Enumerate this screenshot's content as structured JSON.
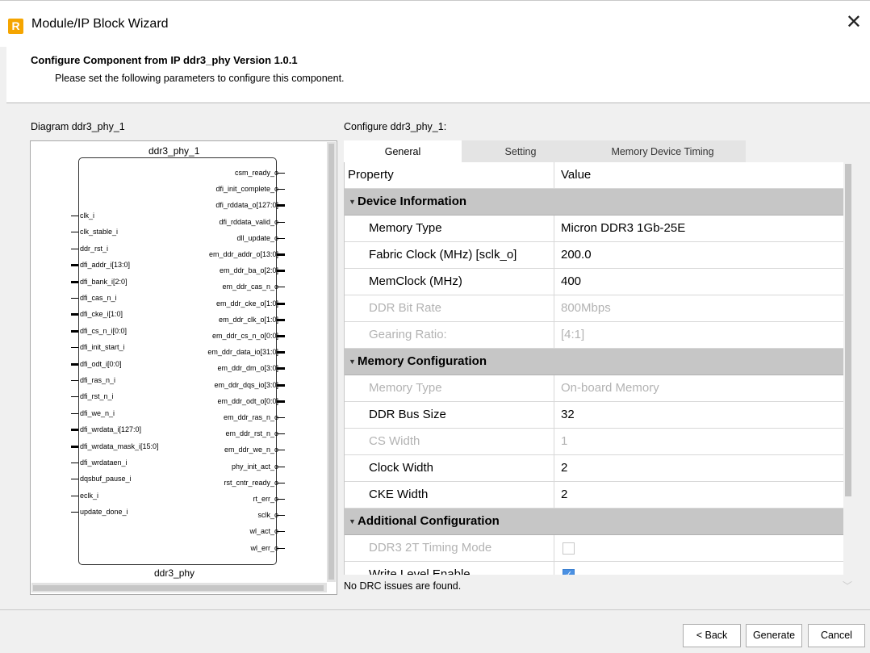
{
  "window": {
    "title": "Module/IP Block Wizard",
    "icon_letter": "R",
    "close_glyph": "✕"
  },
  "header": {
    "title": "Configure Component from IP ddr3_phy Version 1.0.1",
    "subtitle": "Please set the following parameters to configure this component."
  },
  "diagram": {
    "label": "Diagram ddr3_phy_1",
    "instance_name": "ddr3_phy_1",
    "module_name": "ddr3_phy",
    "inputs": [
      {
        "name": "clk_i",
        "bus": false
      },
      {
        "name": "clk_stable_i",
        "bus": false
      },
      {
        "name": "ddr_rst_i",
        "bus": false
      },
      {
        "name": "dfi_addr_i[13:0]",
        "bus": true
      },
      {
        "name": "dfi_bank_i[2:0]",
        "bus": true
      },
      {
        "name": "dfi_cas_n_i",
        "bus": false
      },
      {
        "name": "dfi_cke_i[1:0]",
        "bus": true
      },
      {
        "name": "dfi_cs_n_i[0:0]",
        "bus": true
      },
      {
        "name": "dfi_init_start_i",
        "bus": false
      },
      {
        "name": "dfi_odt_i[0:0]",
        "bus": true
      },
      {
        "name": "dfi_ras_n_i",
        "bus": false
      },
      {
        "name": "dfi_rst_n_i",
        "bus": false
      },
      {
        "name": "dfi_we_n_i",
        "bus": false
      },
      {
        "name": "dfi_wrdata_i[127:0]",
        "bus": true
      },
      {
        "name": "dfi_wrdata_mask_i[15:0]",
        "bus": true
      },
      {
        "name": "dfi_wrdataen_i",
        "bus": false
      },
      {
        "name": "dqsbuf_pause_i",
        "bus": false
      },
      {
        "name": "eclk_i",
        "bus": false
      },
      {
        "name": "update_done_i",
        "bus": false
      }
    ],
    "outputs": [
      {
        "name": "csm_ready_o",
        "bus": false
      },
      {
        "name": "dfi_init_complete_o",
        "bus": false
      },
      {
        "name": "dfi_rddata_o[127:0]",
        "bus": true
      },
      {
        "name": "dfi_rddata_valid_o",
        "bus": false
      },
      {
        "name": "dll_update_o",
        "bus": false
      },
      {
        "name": "em_ddr_addr_o[13:0]",
        "bus": true
      },
      {
        "name": "em_ddr_ba_o[2:0]",
        "bus": true
      },
      {
        "name": "em_ddr_cas_n_o",
        "bus": false
      },
      {
        "name": "em_ddr_cke_o[1:0]",
        "bus": true
      },
      {
        "name": "em_ddr_clk_o[1:0]",
        "bus": true
      },
      {
        "name": "em_ddr_cs_n_o[0:0]",
        "bus": true
      },
      {
        "name": "em_ddr_data_io[31:0]",
        "bus": true
      },
      {
        "name": "em_ddr_dm_o[3:0]",
        "bus": true
      },
      {
        "name": "em_ddr_dqs_io[3:0]",
        "bus": true
      },
      {
        "name": "em_ddr_odt_o[0:0]",
        "bus": true
      },
      {
        "name": "em_ddr_ras_n_o",
        "bus": false
      },
      {
        "name": "em_ddr_rst_n_o",
        "bus": false
      },
      {
        "name": "em_ddr_we_n_o",
        "bus": false
      },
      {
        "name": "phy_init_act_o",
        "bus": false
      },
      {
        "name": "rst_cntr_ready_o",
        "bus": false
      },
      {
        "name": "rt_err_o",
        "bus": false
      },
      {
        "name": "sclk_o",
        "bus": false
      },
      {
        "name": "wl_act_o",
        "bus": false
      },
      {
        "name": "wl_err_o",
        "bus": false
      }
    ]
  },
  "configure": {
    "label": "Configure ddr3_phy_1:",
    "tabs": [
      "General",
      "Setting",
      "Memory Device Timing"
    ],
    "active_tab": "General",
    "columns": {
      "property": "Property",
      "value": "Value"
    },
    "rows": [
      {
        "kind": "section",
        "label": "Device Information"
      },
      {
        "kind": "row",
        "label": "Memory Type",
        "value": "Micron DDR3 1Gb-25E",
        "enabled": true
      },
      {
        "kind": "row",
        "label": "Fabric Clock (MHz) [sclk_o]",
        "value": "200.0",
        "enabled": true
      },
      {
        "kind": "row",
        "label": "MemClock (MHz)",
        "value": "400",
        "enabled": true
      },
      {
        "kind": "row",
        "label": "DDR Bit Rate",
        "value": "800Mbps",
        "enabled": false
      },
      {
        "kind": "row",
        "label": "Gearing Ratio:",
        "value": "[4:1]",
        "enabled": false
      },
      {
        "kind": "section",
        "label": "Memory Configuration"
      },
      {
        "kind": "row",
        "label": "Memory Type",
        "value": "On-board Memory",
        "enabled": false
      },
      {
        "kind": "row",
        "label": "DDR Bus Size",
        "value": "32",
        "enabled": true
      },
      {
        "kind": "row",
        "label": "CS Width",
        "value": "1",
        "enabled": false
      },
      {
        "kind": "row",
        "label": "Clock Width",
        "value": "2",
        "enabled": true
      },
      {
        "kind": "row",
        "label": "CKE Width",
        "value": "2",
        "enabled": true
      },
      {
        "kind": "section",
        "label": "Additional Configuration"
      },
      {
        "kind": "check",
        "label": "DDR3 2T Timing Mode",
        "checked": false,
        "enabled": false
      },
      {
        "kind": "check",
        "label": "Write Level Enable",
        "checked": true,
        "enabled": true
      }
    ],
    "drc_message": "No DRC issues are found."
  },
  "buttons": {
    "back": "< Back",
    "generate": "Generate",
    "cancel": "Cancel"
  },
  "colors": {
    "accent_orange": "#f5a500",
    "section_bg": "#c6c6c6",
    "checkbox_on": "#4a90e2",
    "disabled_text": "#b3b3b3"
  }
}
